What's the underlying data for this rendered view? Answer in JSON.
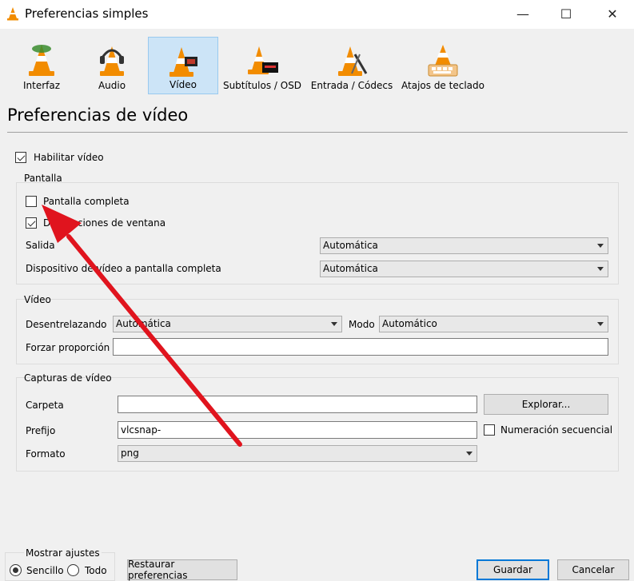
{
  "window": {
    "title": "Preferencias simples",
    "minimize": "—",
    "maximize": "☐",
    "close": "✕"
  },
  "categories": [
    {
      "id": "interfaz",
      "label": "Interfaz",
      "icon": "vlc-cone-icon"
    },
    {
      "id": "audio",
      "label": "Audio",
      "icon": "headphones-cone-icon"
    },
    {
      "id": "video",
      "label": "Vídeo",
      "icon": "film-cone-icon",
      "selected": true
    },
    {
      "id": "subtitulos",
      "label": "Subtítulos / OSD",
      "icon": "display-cone-icon"
    },
    {
      "id": "entrada",
      "label": "Entrada / Códecs",
      "icon": "codec-cone-icon"
    },
    {
      "id": "atajos",
      "label": "Atajos de teclado",
      "icon": "keyboard-cone-icon"
    }
  ],
  "page_title": "Preferencias de vídeo",
  "enable_video": {
    "label": "Habilitar vídeo",
    "checked": true
  },
  "pantalla": {
    "title": "Pantalla",
    "fullscreen": {
      "label": "Pantalla completa",
      "checked": false
    },
    "decorations": {
      "label": "Decoraciones de ventana",
      "checked": true
    },
    "output": {
      "label": "Salida",
      "value": "Automática"
    },
    "fs_device": {
      "label": "Dispositivo de vídeo a pantalla completa",
      "value": "Automática"
    }
  },
  "video": {
    "title": "Vídeo",
    "deinterlace": {
      "label": "Desentrelazando",
      "value": "Automática"
    },
    "mode": {
      "label": "Modo",
      "value": "Automático"
    },
    "aspect": {
      "label": "Forzar proporción",
      "value": ""
    }
  },
  "snapshots": {
    "title": "Capturas de vídeo",
    "folder": {
      "label": "Carpeta",
      "value": ""
    },
    "browse": "Explorar...",
    "prefix": {
      "label": "Prefijo",
      "value": "vlcsnap-"
    },
    "sequential": {
      "label": "Numeración secuencial",
      "checked": false
    },
    "format": {
      "label": "Formato",
      "value": "png"
    }
  },
  "show_settings": {
    "title": "Mostrar ajustes",
    "simple": "Sencillo",
    "all": "Todo",
    "selected": "simple"
  },
  "buttons": {
    "reset": "Restaurar preferencias",
    "save": "Guardar",
    "cancel": "Cancelar"
  },
  "annotation": {
    "color": "#e0141e"
  }
}
